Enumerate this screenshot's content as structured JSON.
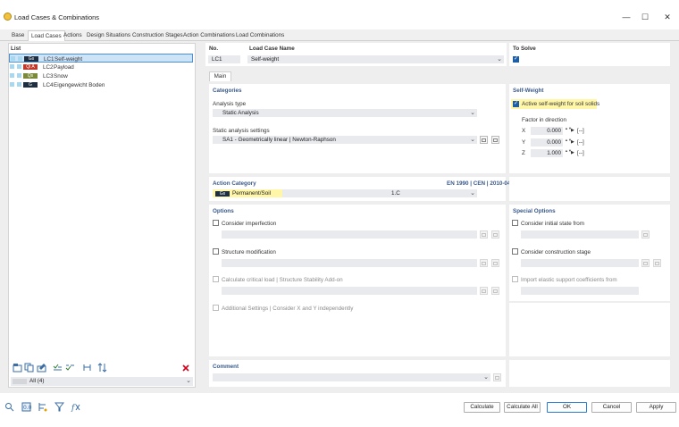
{
  "window": {
    "title": "Load Cases & Combinations",
    "controls": {
      "minimize": "—",
      "maximize": "☐",
      "close": "✕"
    }
  },
  "tabs": [
    "Base",
    "Load Cases",
    "Actions",
    "Design Situations",
    "Construction Stages",
    "Action Combinations",
    "Load Combinations"
  ],
  "active_tab": "Load Cases",
  "list": {
    "title": "List",
    "items": [
      {
        "badge": "Gs",
        "badge_color": "#1f2f3f",
        "code": "LC1",
        "name": "Self-weight",
        "selected": true
      },
      {
        "badge": "Qi A",
        "badge_color": "#c0392b",
        "code": "LC2",
        "name": "Payload"
      },
      {
        "badge": "Qs",
        "badge_color": "#7a8a3a",
        "code": "LC3",
        "name": "Snow"
      },
      {
        "badge": "G",
        "badge_color": "#1f2f3f",
        "code": "LC4",
        "name": "Eigengewicht Boden"
      }
    ],
    "filter": "All (4)"
  },
  "header": {
    "no_label": "No.",
    "no_value": "LC1",
    "name_label": "Load Case Name",
    "name_value": "Self-weight",
    "solve_label": "To Solve"
  },
  "subtab": "Main",
  "categories": {
    "title": "Categories",
    "analysis_type_label": "Analysis type",
    "analysis_type_value": "Static Analysis",
    "static_settings_label": "Static analysis settings",
    "static_settings_value": "SA1 - Geometrically linear | Newton-Raphson"
  },
  "self_weight": {
    "title": "Self-Weight",
    "active_label": "Active self-weight for soil solids",
    "factor_label": "Factor in direction",
    "rows": [
      {
        "axis": "X",
        "value": "0.000",
        "unit": "[--]"
      },
      {
        "axis": "Y",
        "value": "0.000",
        "unit": "[--]"
      },
      {
        "axis": "Z",
        "value": "1.000",
        "unit": "[--]"
      }
    ]
  },
  "action_category": {
    "title": "Action Category",
    "standard": "EN 1990 | CEN | 2010-04",
    "badge": "Gs",
    "value": "Permanent/Soil",
    "code": "1.C"
  },
  "options": {
    "title": "Options",
    "consider_imperfection": "Consider imperfection",
    "structure_modification": "Structure modification",
    "critical_load": "Calculate critical load | Structure Stability Add-on",
    "additional_settings": "Additional Settings | Consider X and Y independently"
  },
  "special_options": {
    "title": "Special Options",
    "initial_state": "Consider initial state from",
    "construction_stage": "Consider construction stage",
    "elastic_support": "Import elastic support coefficients from"
  },
  "comment": {
    "title": "Comment"
  },
  "buttons": {
    "calculate": "Calculate",
    "calculate_all": "Calculate All",
    "ok": "OK",
    "cancel": "Cancel",
    "apply": "Apply"
  },
  "colors": {
    "accent": "#1e5ea8",
    "section_title": "#3a5a8a",
    "highlight": "#fff6a8",
    "delete": "#d0021b"
  }
}
